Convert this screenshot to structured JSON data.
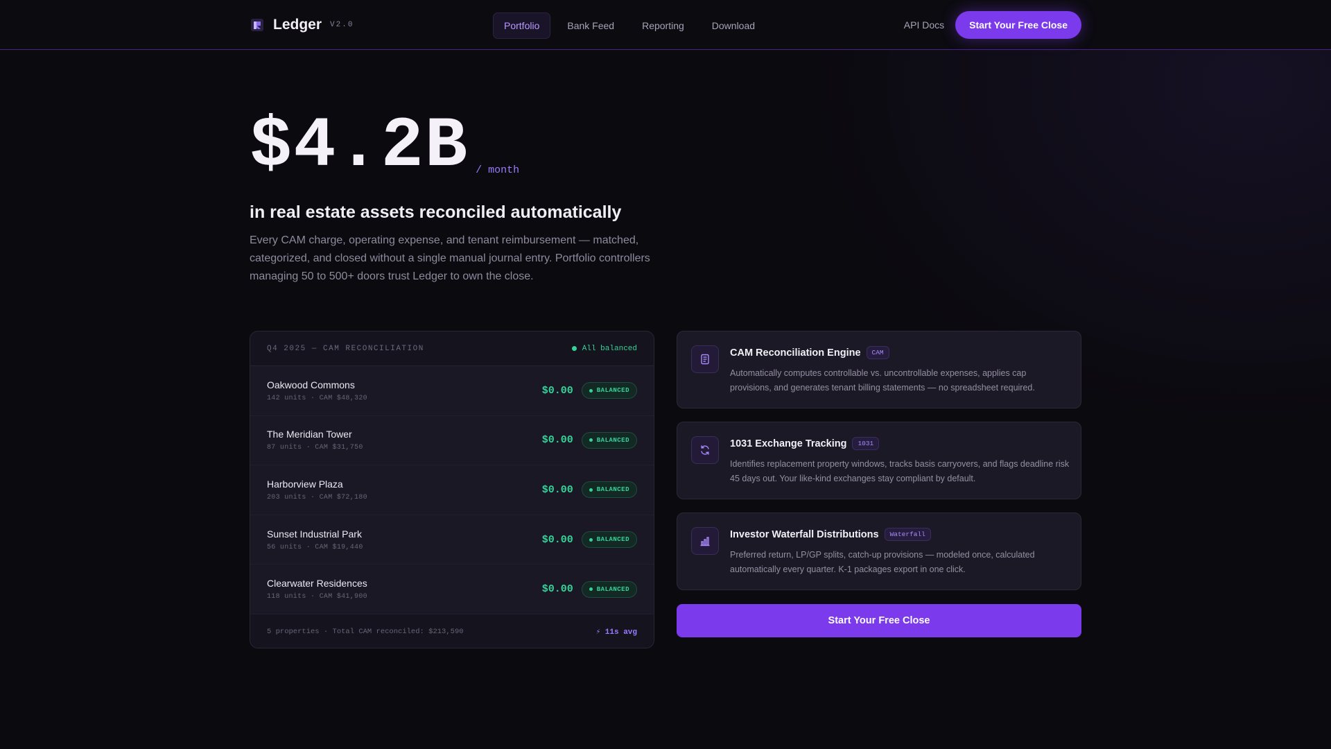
{
  "nav": {
    "brand": "Ledger",
    "version": "V2.0",
    "links": [
      {
        "label": "Portfolio",
        "active": true
      },
      {
        "label": "Bank Feed",
        "active": false
      },
      {
        "label": "Reporting",
        "active": false
      },
      {
        "label": "Download",
        "active": false
      }
    ],
    "api_docs": "API Docs",
    "cta": "Start Your Free Close"
  },
  "hero": {
    "amount": "$4.2B",
    "unit": "/ month",
    "title": "in real estate assets reconciled automatically",
    "description": "Every CAM charge, operating expense, and tenant reimbursement — matched, categorized, and closed without a single manual journal entry. Portfolio controllers managing 50 to 500+ doors trust Ledger to own the close."
  },
  "reconciliation": {
    "title": "Q4 2025 — CAM RECONCILIATION",
    "status": "All balanced",
    "rows": [
      {
        "name": "Oakwood Commons",
        "meta": "142 units · CAM $48,320",
        "amount": "$0.00",
        "badge": "BALANCED"
      },
      {
        "name": "The Meridian Tower",
        "meta": "87 units · CAM $31,750",
        "amount": "$0.00",
        "badge": "BALANCED"
      },
      {
        "name": "Harborview Plaza",
        "meta": "203 units · CAM $72,180",
        "amount": "$0.00",
        "badge": "BALANCED"
      },
      {
        "name": "Sunset Industrial Park",
        "meta": "56 units · CAM $19,440",
        "amount": "$0.00",
        "badge": "BALANCED"
      },
      {
        "name": "Clearwater Residences",
        "meta": "118 units · CAM $41,900",
        "amount": "$0.00",
        "badge": "BALANCED"
      }
    ],
    "footer": "5 properties · Total CAM reconciled: $213,590",
    "speed": "⚡ 11s avg"
  },
  "features": [
    {
      "title": "CAM Reconciliation Engine",
      "tag": "CAM",
      "icon": "document-icon",
      "description": "Automatically computes controllable vs. uncontrollable expenses, applies cap provisions, and generates tenant billing statements — no spreadsheet required."
    },
    {
      "title": "1031 Exchange Tracking",
      "tag": "1031",
      "icon": "refresh-icon",
      "description": "Identifies replacement property windows, tracks basis carryovers, and flags deadline risk 45 days out. Your like-kind exchanges stay compliant by default."
    },
    {
      "title": "Investor Waterfall Distributions",
      "tag": "Waterfall",
      "icon": "bar-chart-icon",
      "description": "Preferred return, LP/GP splits, catch-up provisions — modeled once, calculated automatically every quarter. K-1 packages export in one click."
    }
  ],
  "cta_button": "Start Your Free Close",
  "colors": {
    "accent": "#7c3aed",
    "accent_light": "#9a7cff",
    "success": "#34d399",
    "background": "#0b0a0f"
  }
}
